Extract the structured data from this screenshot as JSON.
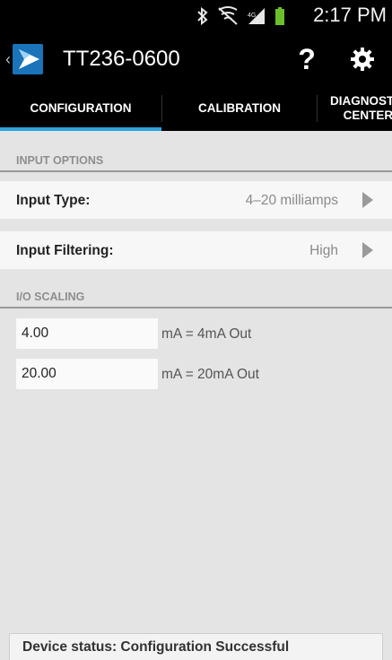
{
  "status_bar": {
    "time": "2:17 PM",
    "icons": [
      "bluetooth-icon",
      "signal-muted-icon",
      "cell-signal-icon",
      "battery-icon"
    ]
  },
  "action_bar": {
    "title": "TT236-0600",
    "help_label": "?",
    "icons": [
      "back-chevron-icon",
      "app-logo-icon",
      "gear-icon"
    ]
  },
  "tabs": [
    {
      "label": "CONFIGURATION",
      "selected": true
    },
    {
      "label": "CALIBRATION",
      "selected": false
    },
    {
      "label": "DIAGNOSTIC\nCENTER",
      "selected": false
    }
  ],
  "input_options": {
    "header": "INPUT OPTIONS",
    "input_type": {
      "label": "Input Type:",
      "value": "4–20 milliamps"
    },
    "input_filtering": {
      "label": "Input Filtering:",
      "value": "High"
    }
  },
  "io_scaling": {
    "header": "I/O SCALING",
    "low": {
      "value": "4.00",
      "label": "mA = 4mA Out"
    },
    "high": {
      "value": "20.00",
      "label": "mA = 20mA Out"
    }
  },
  "device_status": "Device status:  Configuration Successful",
  "colors": {
    "tab_indicator": "#2ea3e2",
    "logo": "#1b73b9",
    "background": "#e4e4e4"
  }
}
